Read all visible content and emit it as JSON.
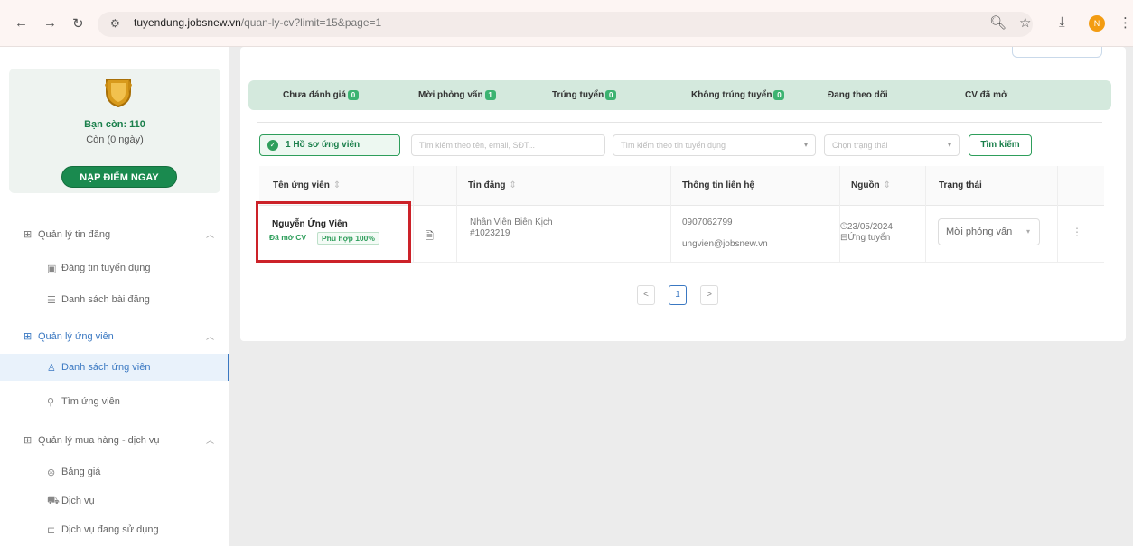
{
  "browser": {
    "url_host": "tuyendung.jobsnew.vn",
    "url_path": "/quan-ly-cv?limit=15&page=1",
    "profile_initial": "N"
  },
  "sidebar": {
    "balance": "Bạn còn: 110",
    "days_left": "Còn (0 ngày)",
    "topup_button": "NẠP ĐIỂM NGAY",
    "groups": [
      {
        "label": "Quản lý tin đăng",
        "icon": "grid-icon",
        "items": [
          {
            "label": "Đăng tin tuyển dụng",
            "icon": "post-icon"
          },
          {
            "label": "Danh sách bài đăng",
            "icon": "list-icon"
          }
        ]
      },
      {
        "label": "Quản lý ứng viên",
        "icon": "grid-icon",
        "items": [
          {
            "label": "Danh sách ứng viên",
            "icon": "user-icon"
          },
          {
            "label": "Tìm ứng viên",
            "icon": "search-icon"
          }
        ]
      },
      {
        "label": "Quản lý mua hàng - dịch vụ",
        "icon": "grid-icon",
        "items": [
          {
            "label": "Bảng giá",
            "icon": "price-icon"
          },
          {
            "label": "Dịch vụ",
            "icon": "cart-icon"
          },
          {
            "label": "Dịch vụ đang sử dụng",
            "icon": "service-icon"
          }
        ]
      }
    ]
  },
  "status_tabs": [
    {
      "label": "Chưa đánh giá",
      "count": "0"
    },
    {
      "label": "Mời phỏng vấn",
      "count": "1"
    },
    {
      "label": "Trúng tuyển",
      "count": "0"
    },
    {
      "label": "Không trúng tuyển",
      "count": "0"
    },
    {
      "label": "Đang theo dõi"
    },
    {
      "label": "CV đã mở"
    }
  ],
  "filters": {
    "result_count": "1 Hồ sơ ứng viên",
    "search_placeholder": "Tìm kiếm theo tên, email, SĐT...",
    "job_placeholder": "Tìm kiếm theo tin tuyển dụng",
    "status_placeholder": "Chọn trạng thái",
    "search_button": "Tìm kiếm"
  },
  "table": {
    "columns": [
      "Tên ứng viên",
      "Tin đăng",
      "Thông tin liên hệ",
      "Nguồn",
      "Trạng thái"
    ],
    "rows": [
      {
        "name": "Nguyễn Ứng Viên",
        "tag_opened": "Đã mở CV",
        "tag_match": "Phù hợp 100%",
        "job_title": "Nhân Viên Biên Kịch",
        "job_id": "#1023219",
        "phone": "0907062799",
        "email": "ungvien@jobsnew.vn",
        "source_date": "23/05/2024",
        "source_type": "Ứng tuyển",
        "status": "Mời phỏng vấn"
      }
    ]
  },
  "pagination": {
    "prev": "<",
    "current": "1",
    "next": ">"
  }
}
